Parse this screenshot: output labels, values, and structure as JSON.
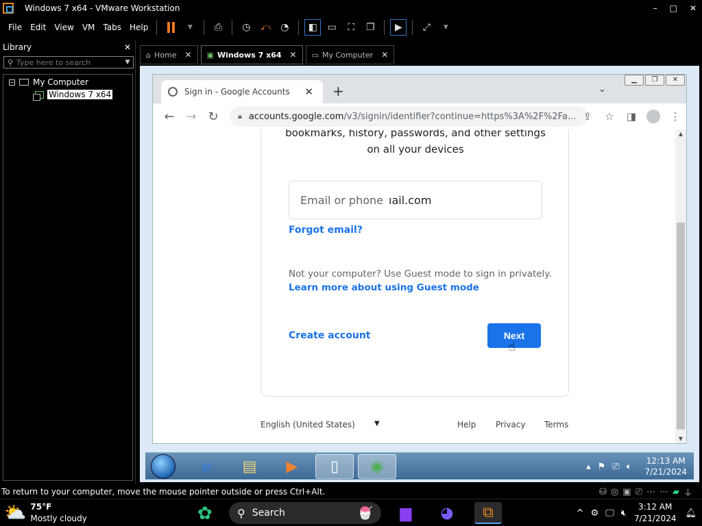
{
  "window": {
    "title": "Windows 7 x64 - VMware Workstation",
    "minimize": "–",
    "maximize": "□",
    "close": "✕"
  },
  "menu": [
    "File",
    "Edit",
    "View",
    "VM",
    "Tabs",
    "Help"
  ],
  "library": {
    "title": "Library",
    "close": "✕",
    "search_placeholder": "Type here to search",
    "tree": {
      "root": "My Computer",
      "child": "Windows 7 x64"
    }
  },
  "tabs": [
    {
      "label": "Home",
      "close": "✕"
    },
    {
      "label": "Windows 7 x64",
      "close": "✕"
    },
    {
      "label": "My Computer",
      "close": "✕"
    }
  ],
  "chrome": {
    "tab_title": "Sign in - Google Accounts",
    "tab_close": "✕",
    "new_tab": "+",
    "url_host": "accounts.google.com",
    "url_path": "/v3/signin/identifier?continue=https%3A%2F%2Fa..."
  },
  "signin": {
    "sync_line1": "bookmarks, history, passwords, and other settings",
    "sync_line2": "on all your devices",
    "email_label": "Email or phone",
    "email_value": "ıail.com",
    "forgot": "Forgot email?",
    "guest_text": "Not your computer? Use Guest mode to sign in privately.",
    "guest_link": "Learn more about using Guest mode",
    "create": "Create account",
    "next": "Next"
  },
  "footer": {
    "language": "English (United States)",
    "help": "Help",
    "privacy": "Privacy",
    "terms": "Terms"
  },
  "win7_clock": {
    "time": "12:13 AM",
    "date": "7/21/2024"
  },
  "hint": "To return to your computer, move the mouse pointer outside or press Ctrl+Alt.",
  "host": {
    "temp": "75°F",
    "weather": "Mostly cloudy",
    "search": "Search",
    "time": "3:12 AM",
    "date": "7/21/2024"
  }
}
